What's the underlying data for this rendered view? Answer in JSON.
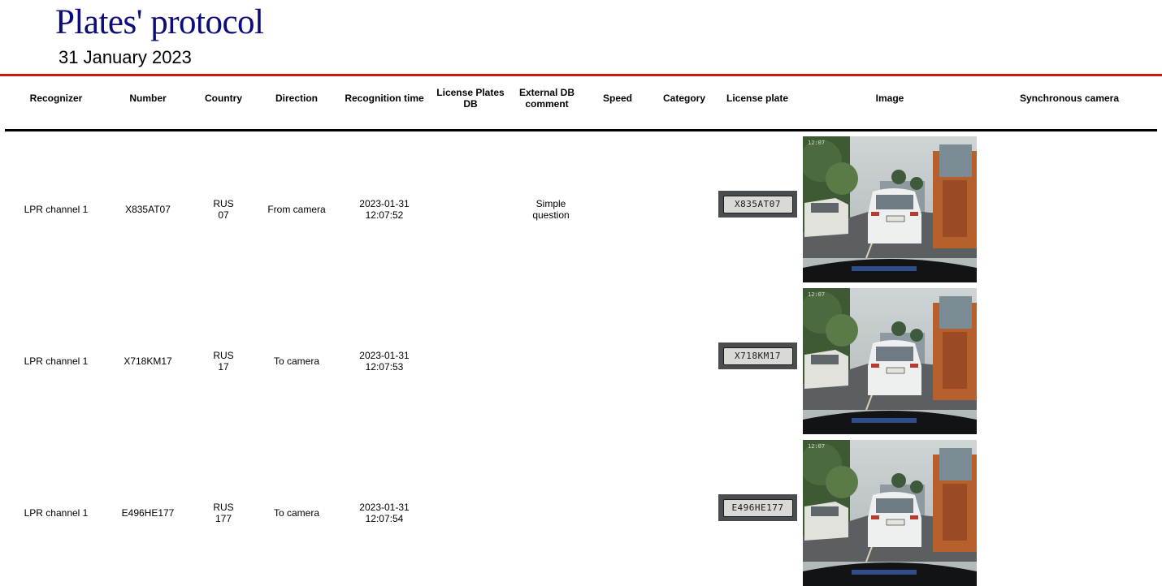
{
  "report": {
    "title": "Plates' protocol",
    "date": "31 January 2023"
  },
  "columns": {
    "recognizer": "Recognizer",
    "number": "Number",
    "country": "Country",
    "direction": "Direction",
    "recognition_time": "Recognition time",
    "license_plates_db": "License Plates\nDB",
    "external_db_comment": "External DB\ncomment",
    "speed": "Speed",
    "category": "Category",
    "license_plate": "License plate",
    "image": "Image",
    "synchronous_camera": "Synchronous camera"
  },
  "rows": [
    {
      "recognizer": "LPR channel  1",
      "number": "X835AT07",
      "country": "RUS\n07",
      "direction": "From camera",
      "recognition_time": "2023-01-31\n12:07:52",
      "license_plates_db": "",
      "external_db_comment": "Simple\nquestion",
      "speed": "",
      "category": "",
      "plate_image_text": "X835AT07"
    },
    {
      "recognizer": "LPR channel  1",
      "number": "X718KM17",
      "country": "RUS\n17",
      "direction": "To camera",
      "recognition_time": "2023-01-31\n12:07:53",
      "license_plates_db": "",
      "external_db_comment": "",
      "speed": "",
      "category": "",
      "plate_image_text": "X718KM17"
    },
    {
      "recognizer": "LPR channel  1",
      "number": "E496HE177",
      "country": "RUS\n177",
      "direction": "To camera",
      "recognition_time": "2023-01-31\n12:07:54",
      "license_plates_db": "",
      "external_db_comment": "",
      "speed": "",
      "category": "",
      "plate_image_text": "E496HE177"
    }
  ],
  "colors": {
    "title": "#0b0b7c",
    "header_rule": "#d01515",
    "table_rule": "#000000"
  }
}
